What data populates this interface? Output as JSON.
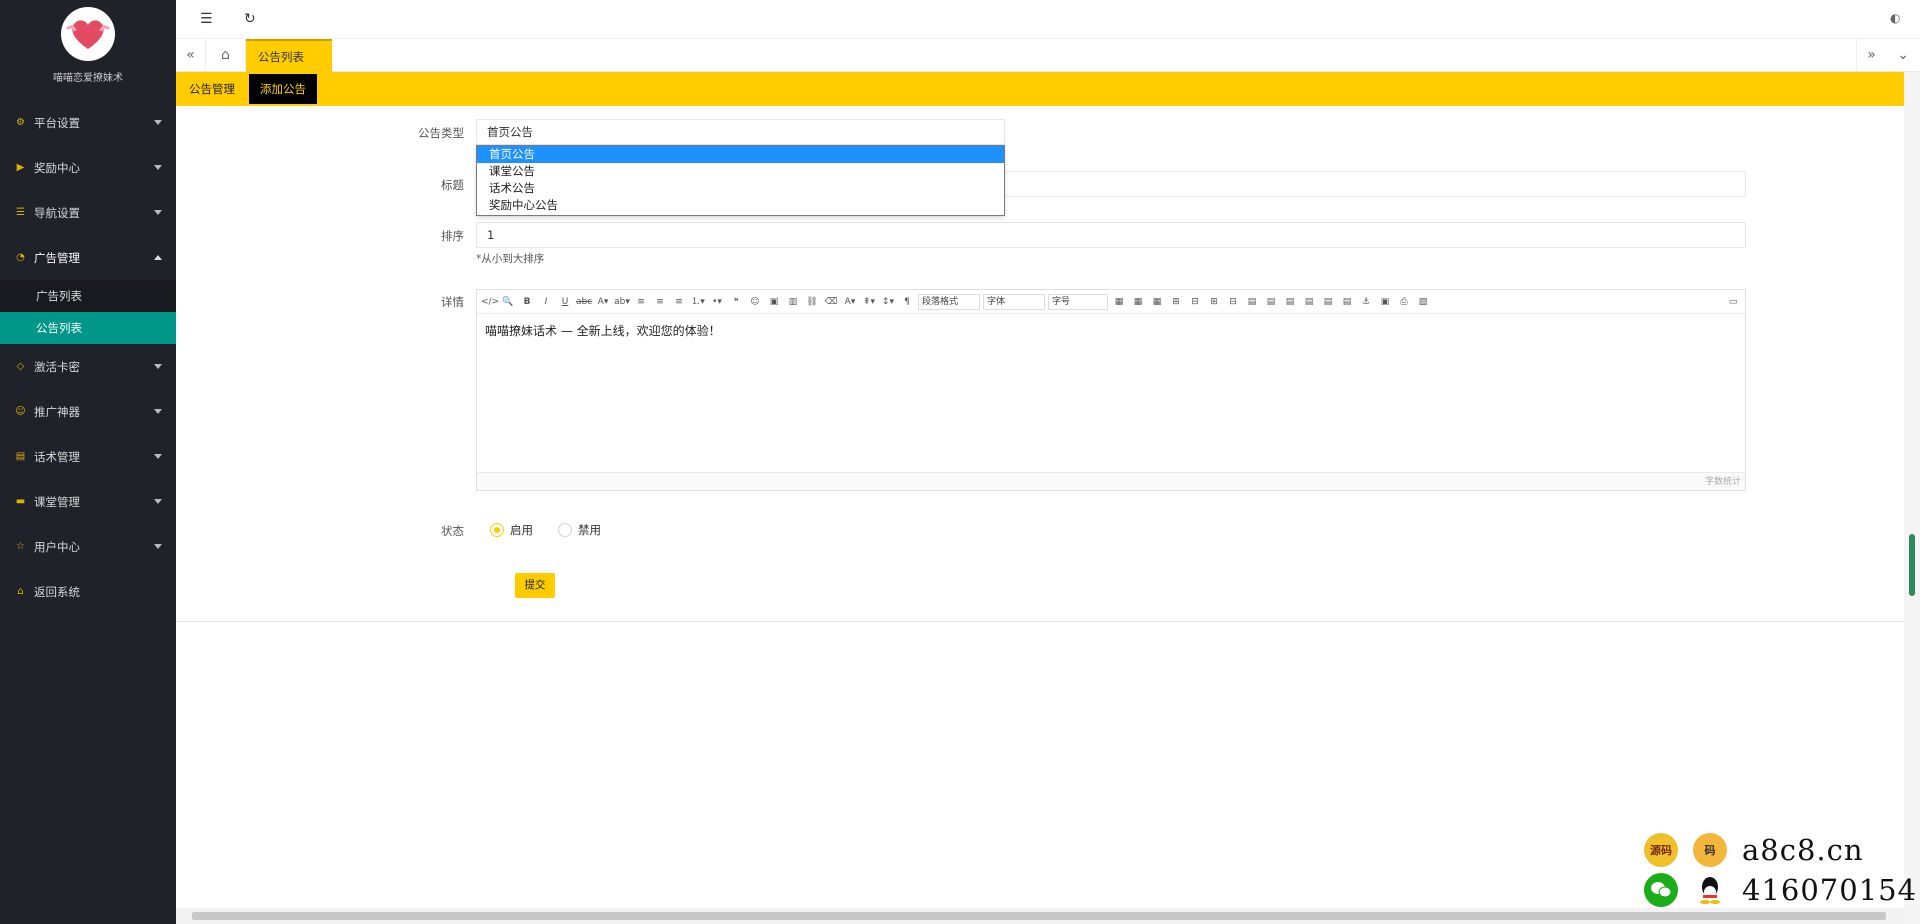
{
  "sidebar": {
    "site_name": "喵喵恋爱撩妹术",
    "menu": [
      {
        "label": "平台设置",
        "icon": "gear-icon"
      },
      {
        "label": "奖励中心",
        "icon": "play-icon"
      },
      {
        "label": "导航设置",
        "icon": "list-icon"
      },
      {
        "label": "广告管理",
        "icon": "dashboard-icon",
        "open": true
      },
      {
        "label": "激活卡密",
        "icon": "cube-icon"
      },
      {
        "label": "推广神器",
        "icon": "smile-icon"
      },
      {
        "label": "话术管理",
        "icon": "file-icon"
      },
      {
        "label": "课堂管理",
        "icon": "sofa-icon"
      },
      {
        "label": "用户中心",
        "icon": "star-icon"
      },
      {
        "label": "返回系统",
        "icon": "home-icon"
      }
    ],
    "submenu": [
      {
        "label": "广告列表"
      },
      {
        "label": "公告列表",
        "active": true
      }
    ]
  },
  "tabs": {
    "active": "公告列表"
  },
  "subnav": {
    "left": "公告管理",
    "right": "添加公告"
  },
  "form": {
    "type_label": "公告类型",
    "type_value": "首页公告",
    "type_options": [
      "首页公告",
      "课堂公告",
      "话术公告",
      "奖励中心公告"
    ],
    "title_label": "标题",
    "title_value": "",
    "sort_label": "排序",
    "sort_value": "1",
    "sort_hint": "*从小到大排序",
    "detail_label": "详情",
    "editor": {
      "content": "喵喵撩妹话术 — 全新上线，欢迎您的体验！",
      "para_select": "段落格式",
      "font_select": "字体",
      "size_select": "字号",
      "word_count": "字数统计"
    },
    "status_label": "状态",
    "status_on": "启用",
    "status_off": "禁用",
    "submit": "提交"
  },
  "watermark": {
    "domain": "a8c8.cn",
    "qq": "416070154",
    "badge1": "源码",
    "badge2": "码"
  },
  "colors": {
    "accent": "#ffcc00",
    "sidebar_bg": "#20222a",
    "active_sub": "#009688",
    "select_blue": "#1e90ff"
  }
}
